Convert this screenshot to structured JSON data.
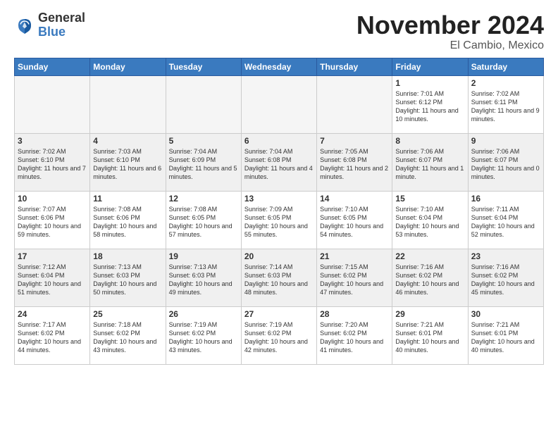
{
  "header": {
    "logo_general": "General",
    "logo_blue": "Blue",
    "title": "November 2024",
    "location": "El Cambio, Mexico"
  },
  "weekdays": [
    "Sunday",
    "Monday",
    "Tuesday",
    "Wednesday",
    "Thursday",
    "Friday",
    "Saturday"
  ],
  "weeks": [
    [
      {
        "day": "",
        "info": "",
        "empty": true
      },
      {
        "day": "",
        "info": "",
        "empty": true
      },
      {
        "day": "",
        "info": "",
        "empty": true
      },
      {
        "day": "",
        "info": "",
        "empty": true
      },
      {
        "day": "",
        "info": "",
        "empty": true
      },
      {
        "day": "1",
        "info": "Sunrise: 7:01 AM\nSunset: 6:12 PM\nDaylight: 11 hours\nand 10 minutes.",
        "empty": false
      },
      {
        "day": "2",
        "info": "Sunrise: 7:02 AM\nSunset: 6:11 PM\nDaylight: 11 hours\nand 9 minutes.",
        "empty": false
      }
    ],
    [
      {
        "day": "3",
        "info": "Sunrise: 7:02 AM\nSunset: 6:10 PM\nDaylight: 11 hours\nand 7 minutes.",
        "empty": false
      },
      {
        "day": "4",
        "info": "Sunrise: 7:03 AM\nSunset: 6:10 PM\nDaylight: 11 hours\nand 6 minutes.",
        "empty": false
      },
      {
        "day": "5",
        "info": "Sunrise: 7:04 AM\nSunset: 6:09 PM\nDaylight: 11 hours\nand 5 minutes.",
        "empty": false
      },
      {
        "day": "6",
        "info": "Sunrise: 7:04 AM\nSunset: 6:08 PM\nDaylight: 11 hours\nand 4 minutes.",
        "empty": false
      },
      {
        "day": "7",
        "info": "Sunrise: 7:05 AM\nSunset: 6:08 PM\nDaylight: 11 hours\nand 2 minutes.",
        "empty": false
      },
      {
        "day": "8",
        "info": "Sunrise: 7:06 AM\nSunset: 6:07 PM\nDaylight: 11 hours\nand 1 minute.",
        "empty": false
      },
      {
        "day": "9",
        "info": "Sunrise: 7:06 AM\nSunset: 6:07 PM\nDaylight: 11 hours\nand 0 minutes.",
        "empty": false
      }
    ],
    [
      {
        "day": "10",
        "info": "Sunrise: 7:07 AM\nSunset: 6:06 PM\nDaylight: 10 hours\nand 59 minutes.",
        "empty": false
      },
      {
        "day": "11",
        "info": "Sunrise: 7:08 AM\nSunset: 6:06 PM\nDaylight: 10 hours\nand 58 minutes.",
        "empty": false
      },
      {
        "day": "12",
        "info": "Sunrise: 7:08 AM\nSunset: 6:05 PM\nDaylight: 10 hours\nand 57 minutes.",
        "empty": false
      },
      {
        "day": "13",
        "info": "Sunrise: 7:09 AM\nSunset: 6:05 PM\nDaylight: 10 hours\nand 55 minutes.",
        "empty": false
      },
      {
        "day": "14",
        "info": "Sunrise: 7:10 AM\nSunset: 6:05 PM\nDaylight: 10 hours\nand 54 minutes.",
        "empty": false
      },
      {
        "day": "15",
        "info": "Sunrise: 7:10 AM\nSunset: 6:04 PM\nDaylight: 10 hours\nand 53 minutes.",
        "empty": false
      },
      {
        "day": "16",
        "info": "Sunrise: 7:11 AM\nSunset: 6:04 PM\nDaylight: 10 hours\nand 52 minutes.",
        "empty": false
      }
    ],
    [
      {
        "day": "17",
        "info": "Sunrise: 7:12 AM\nSunset: 6:04 PM\nDaylight: 10 hours\nand 51 minutes.",
        "empty": false
      },
      {
        "day": "18",
        "info": "Sunrise: 7:13 AM\nSunset: 6:03 PM\nDaylight: 10 hours\nand 50 minutes.",
        "empty": false
      },
      {
        "day": "19",
        "info": "Sunrise: 7:13 AM\nSunset: 6:03 PM\nDaylight: 10 hours\nand 49 minutes.",
        "empty": false
      },
      {
        "day": "20",
        "info": "Sunrise: 7:14 AM\nSunset: 6:03 PM\nDaylight: 10 hours\nand 48 minutes.",
        "empty": false
      },
      {
        "day": "21",
        "info": "Sunrise: 7:15 AM\nSunset: 6:02 PM\nDaylight: 10 hours\nand 47 minutes.",
        "empty": false
      },
      {
        "day": "22",
        "info": "Sunrise: 7:16 AM\nSunset: 6:02 PM\nDaylight: 10 hours\nand 46 minutes.",
        "empty": false
      },
      {
        "day": "23",
        "info": "Sunrise: 7:16 AM\nSunset: 6:02 PM\nDaylight: 10 hours\nand 45 minutes.",
        "empty": false
      }
    ],
    [
      {
        "day": "24",
        "info": "Sunrise: 7:17 AM\nSunset: 6:02 PM\nDaylight: 10 hours\nand 44 minutes.",
        "empty": false
      },
      {
        "day": "25",
        "info": "Sunrise: 7:18 AM\nSunset: 6:02 PM\nDaylight: 10 hours\nand 43 minutes.",
        "empty": false
      },
      {
        "day": "26",
        "info": "Sunrise: 7:19 AM\nSunset: 6:02 PM\nDaylight: 10 hours\nand 43 minutes.",
        "empty": false
      },
      {
        "day": "27",
        "info": "Sunrise: 7:19 AM\nSunset: 6:02 PM\nDaylight: 10 hours\nand 42 minutes.",
        "empty": false
      },
      {
        "day": "28",
        "info": "Sunrise: 7:20 AM\nSunset: 6:02 PM\nDaylight: 10 hours\nand 41 minutes.",
        "empty": false
      },
      {
        "day": "29",
        "info": "Sunrise: 7:21 AM\nSunset: 6:01 PM\nDaylight: 10 hours\nand 40 minutes.",
        "empty": false
      },
      {
        "day": "30",
        "info": "Sunrise: 7:21 AM\nSunset: 6:01 PM\nDaylight: 10 hours\nand 40 minutes.",
        "empty": false
      }
    ]
  ]
}
